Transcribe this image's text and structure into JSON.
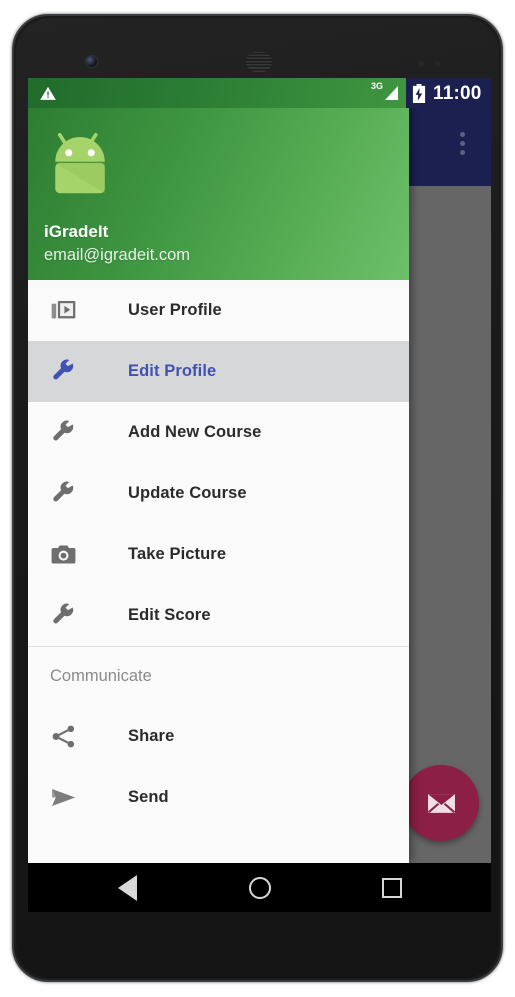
{
  "device": {
    "front_camera": "front-camera",
    "earpiece": "earpiece-speaker",
    "proximity_sensor": "proximity-sensor"
  },
  "statusbar": {
    "warning_icon": "warning-triangle-icon",
    "network_label": "3G",
    "signal_icon": "signal-bars-icon",
    "battery_icon": "battery-charging-icon",
    "clock": "11:00"
  },
  "appbar": {
    "overflow_icon": "overflow-menu-icon",
    "background_color": "#1b2050"
  },
  "drawer": {
    "header": {
      "avatar_icon": "android-robot-avatar",
      "account_name": "iGradeIt",
      "account_email": "email@igradeit.com",
      "gradient_from": "#2e7d32",
      "gradient_to": "#6cc06a"
    },
    "items": [
      {
        "label": "User Profile",
        "icon": "slideshow-icon",
        "selected": false
      },
      {
        "label": "Edit Profile",
        "icon": "wrench-icon",
        "selected": true
      },
      {
        "label": "Add New Course",
        "icon": "wrench-icon",
        "selected": false
      },
      {
        "label": "Update Course",
        "icon": "wrench-icon",
        "selected": false
      },
      {
        "label": "Take Picture",
        "icon": "camera-icon",
        "selected": false
      },
      {
        "label": "Edit Score",
        "icon": "wrench-icon",
        "selected": false
      }
    ],
    "subheader": "Communicate",
    "communicate_items": [
      {
        "label": "Share",
        "icon": "share-icon"
      },
      {
        "label": "Send",
        "icon": "send-icon"
      }
    ],
    "selected_color": "#4152b4",
    "selected_row_background": "#d6d7d8"
  },
  "fab": {
    "icon": "envelope-icon",
    "color": "#8c1f45"
  },
  "navbar": {
    "back": "back-button",
    "home": "home-button",
    "recents": "recents-button"
  }
}
